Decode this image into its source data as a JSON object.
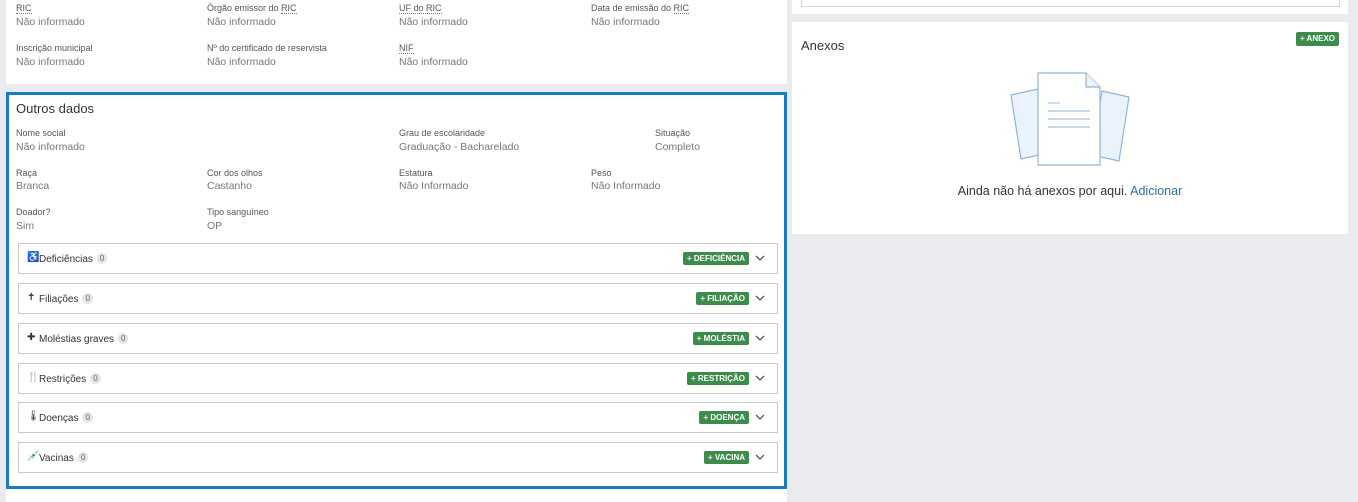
{
  "top_card": {
    "rows": [
      [
        {
          "label": "RIC",
          "value": "Não informado"
        },
        {
          "label": "Órgão emissor do RIC",
          "value": "Não informado"
        },
        {
          "label": "UF do RIC",
          "value": "Não informado"
        },
        {
          "label": "Data de emissão do RIC",
          "value": "Não informado"
        }
      ],
      [
        {
          "label": "Inscrição municipal",
          "value": "Não informado"
        },
        {
          "label": "Nº do certificado de reservista",
          "value": "Não informado"
        },
        {
          "label": "NIF",
          "value": "Não informado"
        }
      ]
    ]
  },
  "outros": {
    "title": "Outros dados",
    "fields": {
      "nome_social": {
        "label": "Nome social",
        "value": "Não informado"
      },
      "escolaridade": {
        "label": "Grau de escolaridade",
        "value": "Graduação - Bacharelado"
      },
      "situacao": {
        "label": "Situação",
        "value": "Completo"
      },
      "raca": {
        "label": "Raça",
        "value": "Branca"
      },
      "olhos": {
        "label": "Cor dos olhos",
        "value": "Castanho"
      },
      "estatura": {
        "label": "Estatura",
        "value": "Não Informado"
      },
      "peso": {
        "label": "Peso",
        "value": "Não Informado"
      },
      "doador": {
        "label": "Doador?",
        "value": "Sim"
      },
      "sangue": {
        "label": "Tipo sanguíneo",
        "value": "OP"
      }
    },
    "sections": [
      {
        "icon": "♿",
        "name": "Deficiências",
        "count": "0",
        "button": "+ DEFICIÊNCIA"
      },
      {
        "icon": "✝",
        "name": "Filiações",
        "count": "0",
        "button": "+ FILIAÇÃO"
      },
      {
        "icon": "✚",
        "name": "Moléstias graves",
        "count": "0",
        "button": "+ MOLÉSTIA"
      },
      {
        "icon": "🍴",
        "name": "Restrições",
        "count": "0",
        "button": "+ RESTRIÇÃO"
      },
      {
        "icon": "🌡",
        "name": "Doenças",
        "count": "0",
        "button": "+ DOENÇA"
      },
      {
        "icon": "💉",
        "name": "Vacinas",
        "count": "0",
        "button": "+ VACINA"
      }
    ]
  },
  "anexos": {
    "title": "Anexos",
    "add_button": "+ ANEXO",
    "empty_text": "Ainda não há anexos por aqui.",
    "empty_link": "Adicionar"
  },
  "colors": {
    "accent_border": "#1a7bbd",
    "button_green": "#3c8c4c",
    "link_blue": "#2a6fb0"
  }
}
